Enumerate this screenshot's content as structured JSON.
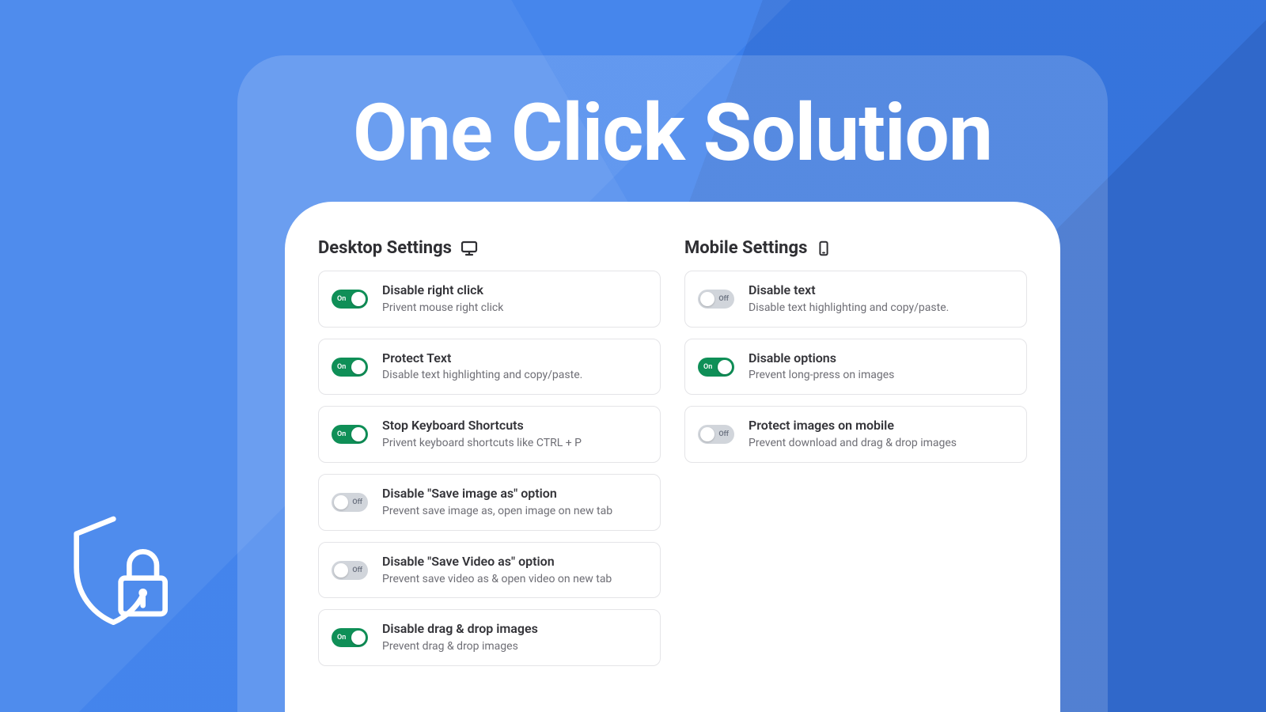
{
  "hero": {
    "title": "One Click Solution"
  },
  "toggle_labels": {
    "on": "On",
    "off": "Off"
  },
  "desktop": {
    "heading": "Desktop Settings",
    "items": [
      {
        "on": true,
        "title": "Disable right click",
        "desc": "Privent mouse right click"
      },
      {
        "on": true,
        "title": "Protect Text",
        "desc": "Disable text highlighting and copy/paste."
      },
      {
        "on": true,
        "title": "Stop Keyboard Shortcuts",
        "desc": "Privent keyboard shortcuts like CTRL + P"
      },
      {
        "on": false,
        "title": "Disable \"Save image as\" option",
        "desc": "Prevent save image as, open image on new tab"
      },
      {
        "on": false,
        "title": "Disable \"Save Video as\" option",
        "desc": "Prevent save video as & open video on new tab"
      },
      {
        "on": true,
        "title": "Disable drag & drop images",
        "desc": "Prevent drag & drop images"
      }
    ]
  },
  "mobile": {
    "heading": "Mobile Settings",
    "items": [
      {
        "on": false,
        "title": "Disable text",
        "desc": "Disable text highlighting and copy/paste."
      },
      {
        "on": true,
        "title": "Disable options",
        "desc": "Prevent long-press on images"
      },
      {
        "on": false,
        "title": "Protect images on mobile",
        "desc": "Prevent download and drag & drop images"
      }
    ]
  }
}
